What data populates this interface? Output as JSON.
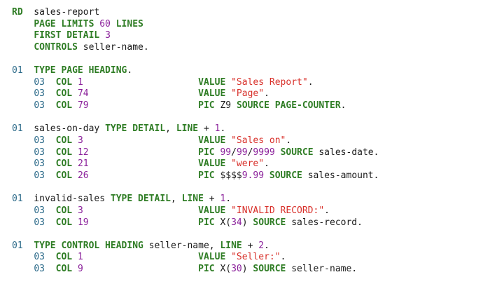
{
  "colors": {
    "keyword": "#2f7d25",
    "number": "#8a1f9a",
    "string": "#d8302a",
    "level": "#2d6b8a",
    "text": "#1a1a1a"
  },
  "code_lines": [
    [
      {
        "t": "kw",
        "s": "RD"
      },
      {
        "t": "txt",
        "s": "  sales-report"
      }
    ],
    [
      {
        "t": "txt",
        "s": "    "
      },
      {
        "t": "kw",
        "s": "PAGE LIMITS"
      },
      {
        "t": "txt",
        "s": " "
      },
      {
        "t": "num",
        "s": "60"
      },
      {
        "t": "txt",
        "s": " "
      },
      {
        "t": "kw",
        "s": "LINES"
      }
    ],
    [
      {
        "t": "txt",
        "s": "    "
      },
      {
        "t": "kw",
        "s": "FIRST DETAIL"
      },
      {
        "t": "txt",
        "s": " "
      },
      {
        "t": "num",
        "s": "3"
      }
    ],
    [
      {
        "t": "txt",
        "s": "    "
      },
      {
        "t": "kw",
        "s": "CONTROLS"
      },
      {
        "t": "txt",
        "s": " seller-name."
      }
    ],
    [],
    [
      {
        "t": "lvl",
        "s": "01"
      },
      {
        "t": "txt",
        "s": "  "
      },
      {
        "t": "kw",
        "s": "TYPE PAGE HEADING"
      },
      {
        "t": "txt",
        "s": "."
      }
    ],
    [
      {
        "t": "txt",
        "s": "    "
      },
      {
        "t": "lvl",
        "s": "03"
      },
      {
        "t": "txt",
        "s": "  "
      },
      {
        "t": "kw",
        "s": "COL"
      },
      {
        "t": "txt",
        "s": " "
      },
      {
        "t": "num",
        "s": "1"
      },
      {
        "t": "txt",
        "s": "                     "
      },
      {
        "t": "kw",
        "s": "VALUE"
      },
      {
        "t": "txt",
        "s": " "
      },
      {
        "t": "str",
        "s": "\"Sales Report\""
      },
      {
        "t": "txt",
        "s": "."
      }
    ],
    [
      {
        "t": "txt",
        "s": "    "
      },
      {
        "t": "lvl",
        "s": "03"
      },
      {
        "t": "txt",
        "s": "  "
      },
      {
        "t": "kw",
        "s": "COL"
      },
      {
        "t": "txt",
        "s": " "
      },
      {
        "t": "num",
        "s": "74"
      },
      {
        "t": "txt",
        "s": "                    "
      },
      {
        "t": "kw",
        "s": "VALUE"
      },
      {
        "t": "txt",
        "s": " "
      },
      {
        "t": "str",
        "s": "\"Page\""
      },
      {
        "t": "txt",
        "s": "."
      }
    ],
    [
      {
        "t": "txt",
        "s": "    "
      },
      {
        "t": "lvl",
        "s": "03"
      },
      {
        "t": "txt",
        "s": "  "
      },
      {
        "t": "kw",
        "s": "COL"
      },
      {
        "t": "txt",
        "s": " "
      },
      {
        "t": "num",
        "s": "79"
      },
      {
        "t": "txt",
        "s": "                    "
      },
      {
        "t": "kw",
        "s": "PIC"
      },
      {
        "t": "txt",
        "s": " Z9 "
      },
      {
        "t": "kw",
        "s": "SOURCE PAGE-COUNTER"
      },
      {
        "t": "txt",
        "s": "."
      }
    ],
    [],
    [
      {
        "t": "lvl",
        "s": "01"
      },
      {
        "t": "txt",
        "s": "  sales-on-day "
      },
      {
        "t": "kw",
        "s": "TYPE DETAIL"
      },
      {
        "t": "txt",
        "s": ", "
      },
      {
        "t": "kw",
        "s": "LINE"
      },
      {
        "t": "txt",
        "s": " + "
      },
      {
        "t": "num",
        "s": "1"
      },
      {
        "t": "txt",
        "s": "."
      }
    ],
    [
      {
        "t": "txt",
        "s": "    "
      },
      {
        "t": "lvl",
        "s": "03"
      },
      {
        "t": "txt",
        "s": "  "
      },
      {
        "t": "kw",
        "s": "COL"
      },
      {
        "t": "txt",
        "s": " "
      },
      {
        "t": "num",
        "s": "3"
      },
      {
        "t": "txt",
        "s": "                     "
      },
      {
        "t": "kw",
        "s": "VALUE"
      },
      {
        "t": "txt",
        "s": " "
      },
      {
        "t": "str",
        "s": "\"Sales on\""
      },
      {
        "t": "txt",
        "s": "."
      }
    ],
    [
      {
        "t": "txt",
        "s": "    "
      },
      {
        "t": "lvl",
        "s": "03"
      },
      {
        "t": "txt",
        "s": "  "
      },
      {
        "t": "kw",
        "s": "COL"
      },
      {
        "t": "txt",
        "s": " "
      },
      {
        "t": "num",
        "s": "12"
      },
      {
        "t": "txt",
        "s": "                    "
      },
      {
        "t": "kw",
        "s": "PIC"
      },
      {
        "t": "txt",
        "s": " "
      },
      {
        "t": "num",
        "s": "99"
      },
      {
        "t": "txt",
        "s": "/"
      },
      {
        "t": "num",
        "s": "99"
      },
      {
        "t": "txt",
        "s": "/"
      },
      {
        "t": "num",
        "s": "9999"
      },
      {
        "t": "txt",
        "s": " "
      },
      {
        "t": "kw",
        "s": "SOURCE"
      },
      {
        "t": "txt",
        "s": " sales-date."
      }
    ],
    [
      {
        "t": "txt",
        "s": "    "
      },
      {
        "t": "lvl",
        "s": "03"
      },
      {
        "t": "txt",
        "s": "  "
      },
      {
        "t": "kw",
        "s": "COL"
      },
      {
        "t": "txt",
        "s": " "
      },
      {
        "t": "num",
        "s": "21"
      },
      {
        "t": "txt",
        "s": "                    "
      },
      {
        "t": "kw",
        "s": "VALUE"
      },
      {
        "t": "txt",
        "s": " "
      },
      {
        "t": "str",
        "s": "\"were\""
      },
      {
        "t": "txt",
        "s": "."
      }
    ],
    [
      {
        "t": "txt",
        "s": "    "
      },
      {
        "t": "lvl",
        "s": "03"
      },
      {
        "t": "txt",
        "s": "  "
      },
      {
        "t": "kw",
        "s": "COL"
      },
      {
        "t": "txt",
        "s": " "
      },
      {
        "t": "num",
        "s": "26"
      },
      {
        "t": "txt",
        "s": "                    "
      },
      {
        "t": "kw",
        "s": "PIC"
      },
      {
        "t": "txt",
        "s": " $$$$"
      },
      {
        "t": "num",
        "s": "9.99"
      },
      {
        "t": "txt",
        "s": " "
      },
      {
        "t": "kw",
        "s": "SOURCE"
      },
      {
        "t": "txt",
        "s": " sales-amount."
      }
    ],
    [],
    [
      {
        "t": "lvl",
        "s": "01"
      },
      {
        "t": "txt",
        "s": "  invalid-sales "
      },
      {
        "t": "kw",
        "s": "TYPE DETAIL"
      },
      {
        "t": "txt",
        "s": ", "
      },
      {
        "t": "kw",
        "s": "LINE"
      },
      {
        "t": "txt",
        "s": " + "
      },
      {
        "t": "num",
        "s": "1"
      },
      {
        "t": "txt",
        "s": "."
      }
    ],
    [
      {
        "t": "txt",
        "s": "    "
      },
      {
        "t": "lvl",
        "s": "03"
      },
      {
        "t": "txt",
        "s": "  "
      },
      {
        "t": "kw",
        "s": "COL"
      },
      {
        "t": "txt",
        "s": " "
      },
      {
        "t": "num",
        "s": "3"
      },
      {
        "t": "txt",
        "s": "                     "
      },
      {
        "t": "kw",
        "s": "VALUE"
      },
      {
        "t": "txt",
        "s": " "
      },
      {
        "t": "str",
        "s": "\"INVALID RECORD:\""
      },
      {
        "t": "txt",
        "s": "."
      }
    ],
    [
      {
        "t": "txt",
        "s": "    "
      },
      {
        "t": "lvl",
        "s": "03"
      },
      {
        "t": "txt",
        "s": "  "
      },
      {
        "t": "kw",
        "s": "COL"
      },
      {
        "t": "txt",
        "s": " "
      },
      {
        "t": "num",
        "s": "19"
      },
      {
        "t": "txt",
        "s": "                    "
      },
      {
        "t": "kw",
        "s": "PIC"
      },
      {
        "t": "txt",
        "s": " X("
      },
      {
        "t": "num",
        "s": "34"
      },
      {
        "t": "txt",
        "s": ") "
      },
      {
        "t": "kw",
        "s": "SOURCE"
      },
      {
        "t": "txt",
        "s": " sales-record."
      }
    ],
    [],
    [
      {
        "t": "lvl",
        "s": "01"
      },
      {
        "t": "txt",
        "s": "  "
      },
      {
        "t": "kw",
        "s": "TYPE CONTROL HEADING"
      },
      {
        "t": "txt",
        "s": " seller-name, "
      },
      {
        "t": "kw",
        "s": "LINE"
      },
      {
        "t": "txt",
        "s": " + "
      },
      {
        "t": "num",
        "s": "2"
      },
      {
        "t": "txt",
        "s": "."
      }
    ],
    [
      {
        "t": "txt",
        "s": "    "
      },
      {
        "t": "lvl",
        "s": "03"
      },
      {
        "t": "txt",
        "s": "  "
      },
      {
        "t": "kw",
        "s": "COL"
      },
      {
        "t": "txt",
        "s": " "
      },
      {
        "t": "num",
        "s": "1"
      },
      {
        "t": "txt",
        "s": "                     "
      },
      {
        "t": "kw",
        "s": "VALUE"
      },
      {
        "t": "txt",
        "s": " "
      },
      {
        "t": "str",
        "s": "\"Seller:\""
      },
      {
        "t": "txt",
        "s": "."
      }
    ],
    [
      {
        "t": "txt",
        "s": "    "
      },
      {
        "t": "lvl",
        "s": "03"
      },
      {
        "t": "txt",
        "s": "  "
      },
      {
        "t": "kw",
        "s": "COL"
      },
      {
        "t": "txt",
        "s": " "
      },
      {
        "t": "num",
        "s": "9"
      },
      {
        "t": "txt",
        "s": "                     "
      },
      {
        "t": "kw",
        "s": "PIC"
      },
      {
        "t": "txt",
        "s": " X("
      },
      {
        "t": "num",
        "s": "30"
      },
      {
        "t": "txt",
        "s": ") "
      },
      {
        "t": "kw",
        "s": "SOURCE"
      },
      {
        "t": "txt",
        "s": " seller-name."
      }
    ]
  ]
}
